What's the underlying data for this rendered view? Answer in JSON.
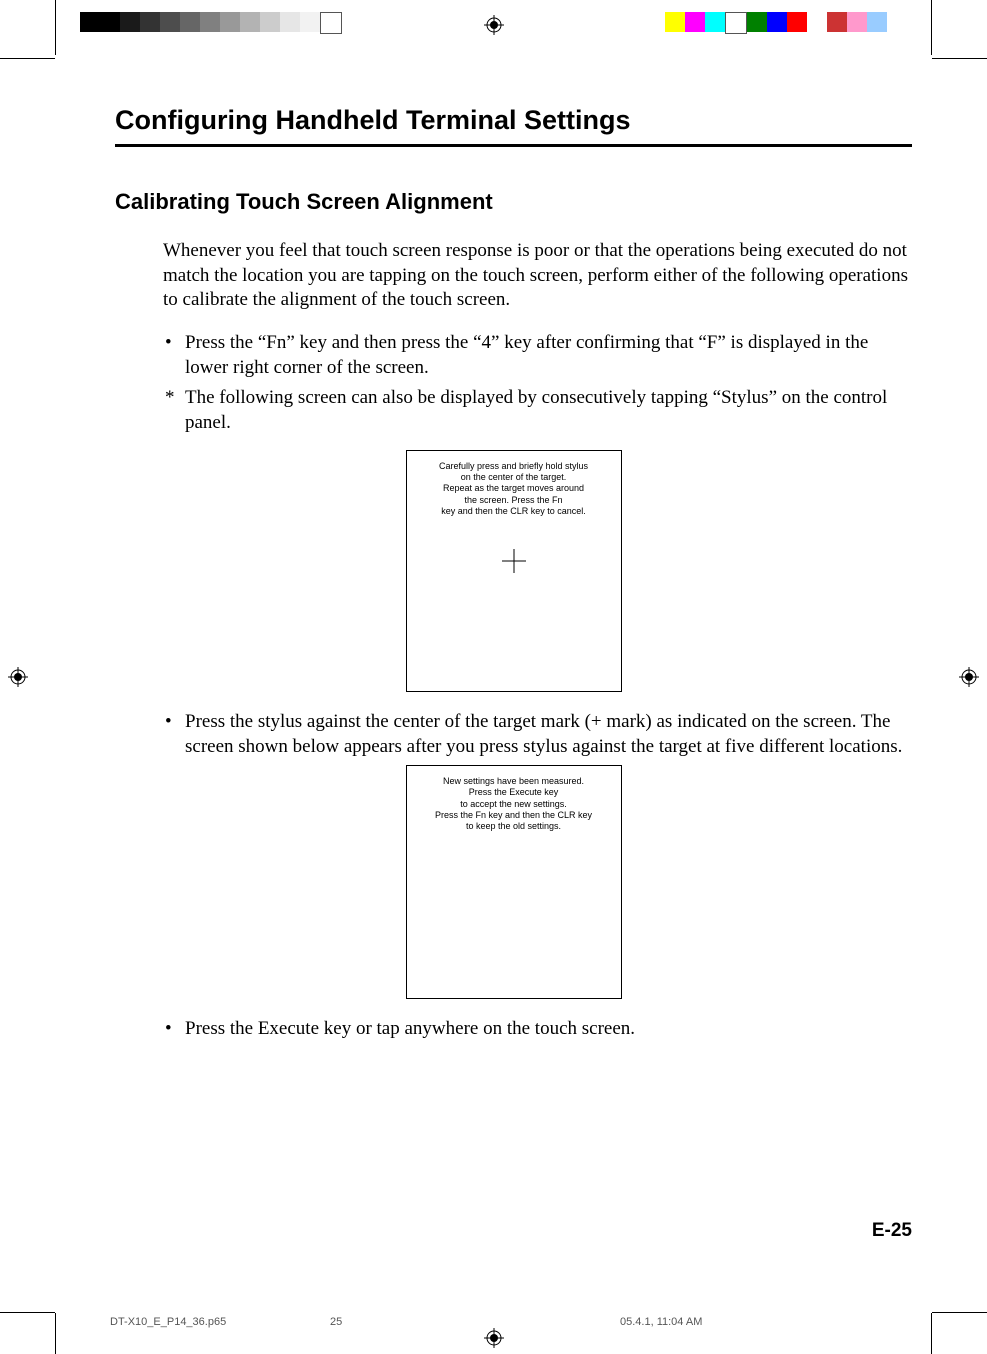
{
  "title": "Configuring Handheld Terminal Settings",
  "section_title": "Calibrating Touch Screen Alignment",
  "intro": "Whenever you feel that touch screen response is poor or that the operations being executed do not match the location you are tapping on the touch screen, perform either of the following operations to calibrate the alignment of the touch screen.",
  "bullet1": "Press the “Fn” key and then press the “4” key after confirming that “F” is displayed in the lower right corner of the screen.",
  "star1": "The following screen can also be displayed by consecutively tapping “Stylus” on the control panel.",
  "screen1": {
    "l1": "Carefully press and briefly hold stylus",
    "l2": "on the center of the target.",
    "l3": "Repeat as the target moves around",
    "l4": "the screen. Press the Fn",
    "l5": "key and then the CLR key to cancel."
  },
  "bullet2": "Press the stylus against the center of the target mark (+ mark) as indicated on the screen. The screen shown below appears after you press stylus against the target at five different locations.",
  "screen2": {
    "l1": "New settings have been measured.",
    "l2": "Press the Execute key",
    "l3": "to accept the new settings.",
    "l4": "Press the Fn key and then the CLR key",
    "l5": "to keep the old settings."
  },
  "bullet3": "Press the Execute key or tap anywhere on the touch screen.",
  "page_number": "E-25",
  "footer": {
    "file": "DT-X10_E_P14_36.p65",
    "page": "25",
    "datetime": "05.4.1, 11:04 AM"
  }
}
